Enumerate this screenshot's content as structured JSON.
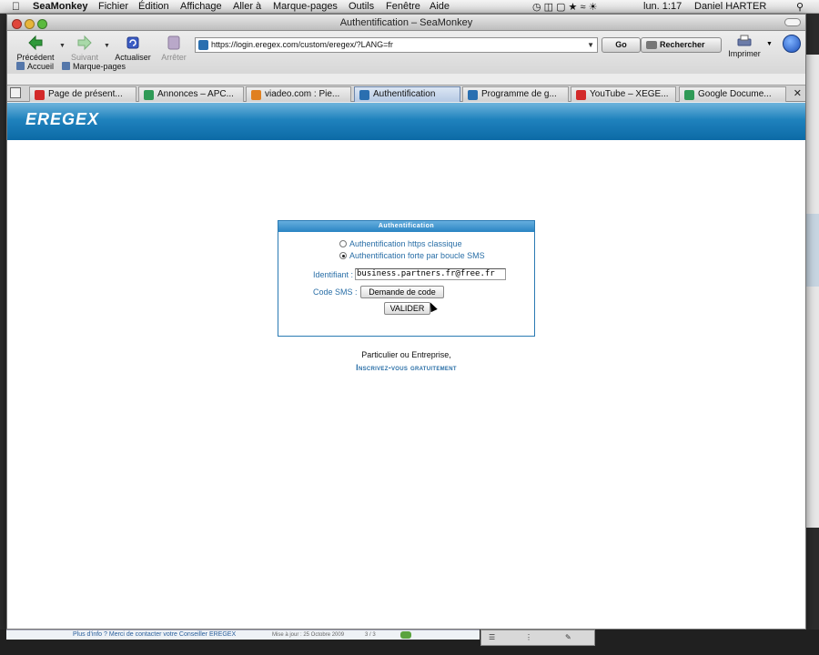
{
  "menubar": {
    "app": "SeaMonkey",
    "items": [
      "Fichier",
      "Édition",
      "Affichage",
      "Aller à",
      "Marque-pages",
      "Outils",
      "Fenêtre",
      "Aide"
    ],
    "clock": "lun. 1:17",
    "user": "Daniel HARTER"
  },
  "window": {
    "title": "Authentification – SeaMonkey"
  },
  "toolbar": {
    "back": "Précédent",
    "forward": "Suivant",
    "reload": "Actualiser",
    "stop": "Arrêter",
    "url": "https://login.eregex.com/custom/eregex/?LANG=fr",
    "go": "Go",
    "search": "Rechercher",
    "print": "Imprimer"
  },
  "bookmarks": {
    "home": "Accueil",
    "bookmarks": "Marque-pages"
  },
  "tabs": [
    {
      "label": "Page de présent...",
      "icon_color": "#d32a2a",
      "active": false
    },
    {
      "label": "Annonces – APC...",
      "icon_color": "#2f9a56",
      "active": false
    },
    {
      "label": "viadeo.com : Pie...",
      "icon_color": "#e08020",
      "active": false
    },
    {
      "label": "Authentification",
      "icon_color": "#2a6fb0",
      "active": true
    },
    {
      "label": "Programme de g...",
      "icon_color": "#2a6fb0",
      "active": false
    },
    {
      "label": "YouTube – XEGE...",
      "icon_color": "#d32a2a",
      "active": false
    },
    {
      "label": "Google Docume...",
      "icon_color": "#2f9a56",
      "active": false
    }
  ],
  "page": {
    "logo": "EREGEX",
    "box_title": "Authentification",
    "radio_https": "Authentification https classique",
    "radio_sms": "Authentification forte par boucle SMS",
    "selected_radio": "sms",
    "id_label": "Identifiant :",
    "id_value": "business.partners.fr@free.fr",
    "sms_label": "Code SMS :",
    "sms_button": "Demande de code",
    "submit": "VALIDER",
    "footer_line": "Particulier ou Entreprise,",
    "footer_link": "Inscrivez-vous gratuitement"
  },
  "background": {
    "info_link": "Plus d'info ? Merci de contacter votre Conseiller EREGEX",
    "updated": "Mise à jour : 25 Octobre 2009",
    "pages": "3 / 3"
  }
}
